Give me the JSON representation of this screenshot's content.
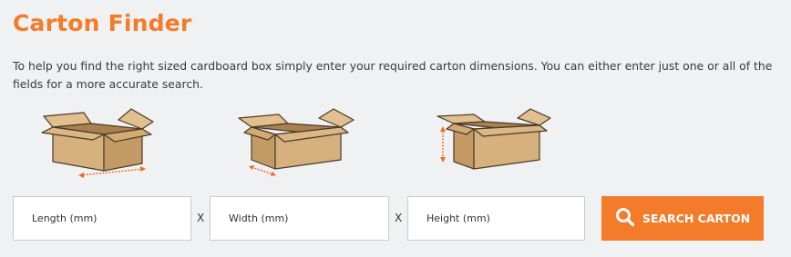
{
  "title": "Carton Finder",
  "intro": "To help you find the right sized cardboard box simply enter your required carton dimensions. You can either enter just one or all of the fields for a more accurate search.",
  "fields": [
    {
      "placeholder": "Length (mm)"
    },
    {
      "placeholder": "Width (mm)"
    },
    {
      "placeholder": "Height (mm)"
    }
  ],
  "separator": "X",
  "search_button": {
    "label": "SEARCH CARTON",
    "icon": "search-icon"
  },
  "illustrations": [
    {
      "icon": "box-length-icon",
      "dimension_arrow": "length"
    },
    {
      "icon": "box-width-icon",
      "dimension_arrow": "width"
    },
    {
      "icon": "box-height-icon",
      "dimension_arrow": "height"
    }
  ],
  "colors": {
    "accent": "#f37b2a",
    "box_front": "#d6b07d",
    "box_side": "#c39a64",
    "box_inside": "#a8814f",
    "outline": "#4a3a28",
    "arrow": "#ef6a22",
    "background": "#f0f1f3"
  }
}
